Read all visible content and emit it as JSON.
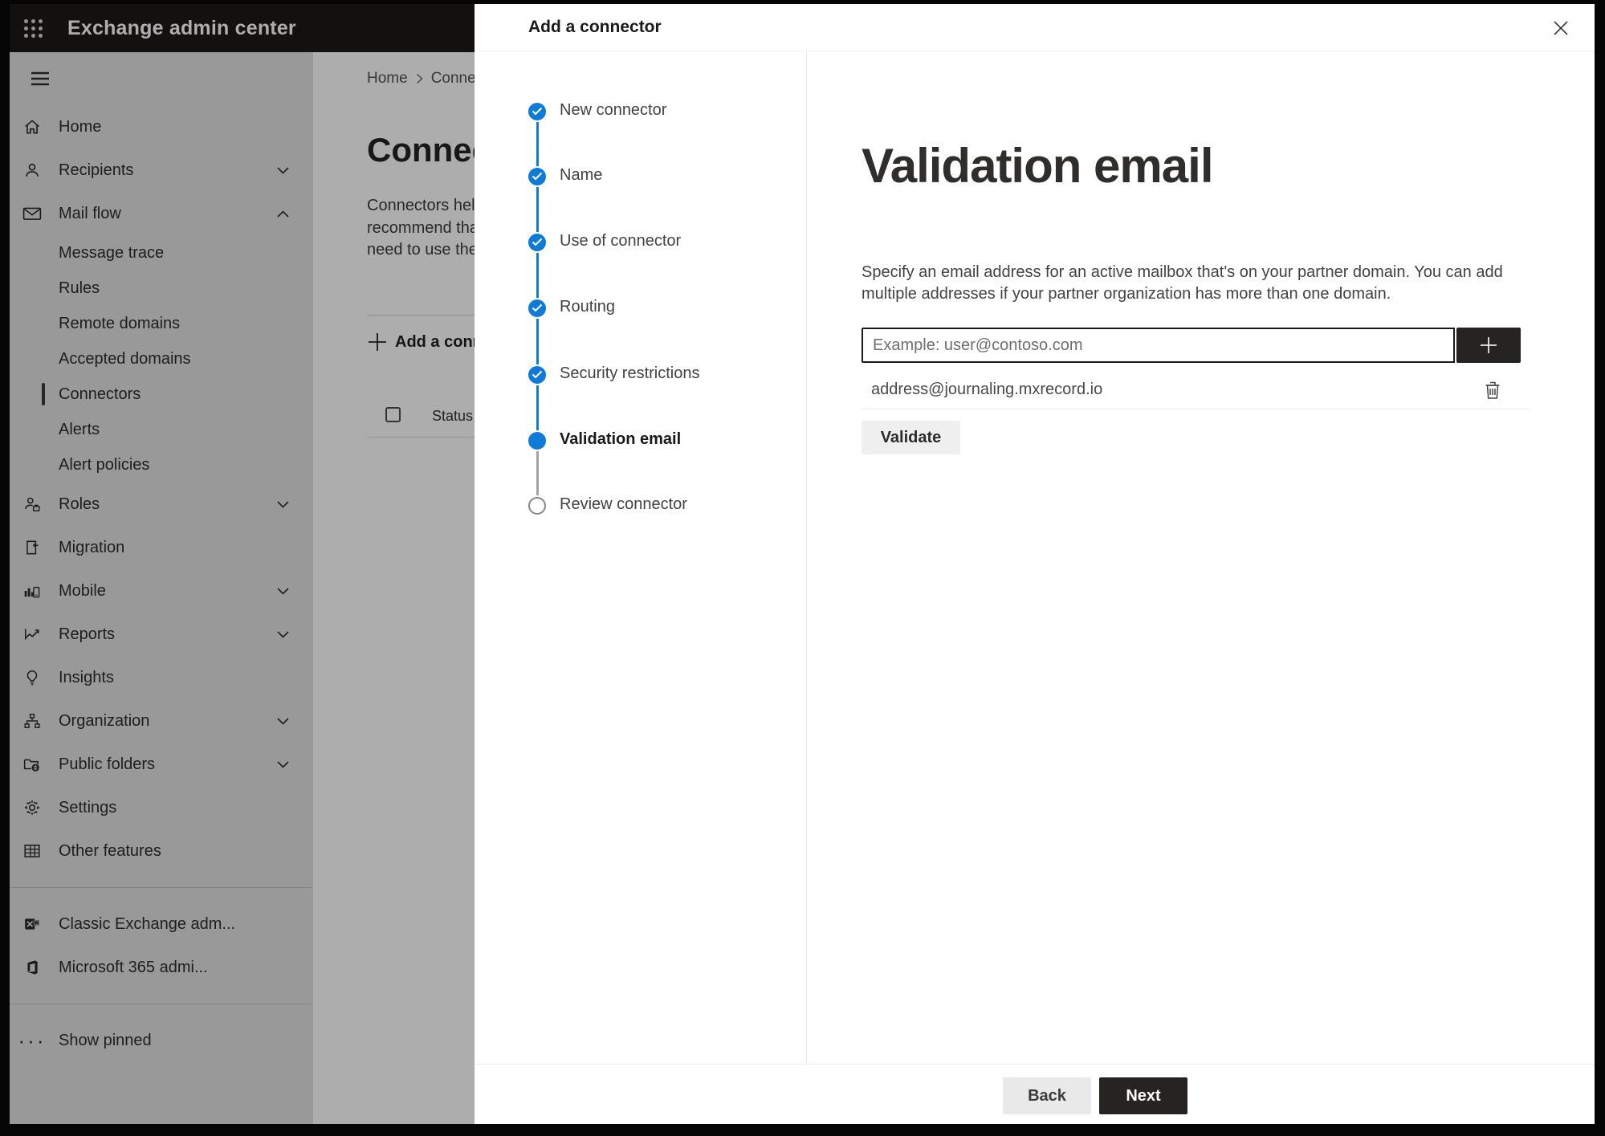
{
  "topbar": {
    "title": "Exchange admin center"
  },
  "sidebar": {
    "items": [
      {
        "label": "Home"
      },
      {
        "label": "Recipients"
      },
      {
        "label": "Mail flow"
      },
      {
        "label": "Message trace"
      },
      {
        "label": "Rules"
      },
      {
        "label": "Remote domains"
      },
      {
        "label": "Accepted domains"
      },
      {
        "label": "Connectors"
      },
      {
        "label": "Alerts"
      },
      {
        "label": "Alert policies"
      },
      {
        "label": "Roles"
      },
      {
        "label": "Migration"
      },
      {
        "label": "Mobile"
      },
      {
        "label": "Reports"
      },
      {
        "label": "Insights"
      },
      {
        "label": "Organization"
      },
      {
        "label": "Public folders"
      },
      {
        "label": "Settings"
      },
      {
        "label": "Other features"
      }
    ],
    "footer_items": [
      {
        "label": "Classic Exchange adm..."
      },
      {
        "label": "Microsoft 365 admi..."
      }
    ],
    "show_pinned_label": "Show pinned"
  },
  "background": {
    "breadcrumb_home": "Home",
    "breadcrumb_current": "Conne",
    "title": "Connec",
    "body_line1": "Connectors help",
    "body_line2": "recommend tha",
    "body_line3": "need to use ther",
    "add_button_label": "Add a conn",
    "status_header": "Status"
  },
  "modal": {
    "title": "Add a connector",
    "steps": [
      {
        "label": "New connector",
        "state": "done"
      },
      {
        "label": "Name",
        "state": "done"
      },
      {
        "label": "Use of connector",
        "state": "done"
      },
      {
        "label": "Routing",
        "state": "done"
      },
      {
        "label": "Security restrictions",
        "state": "done"
      },
      {
        "label": "Validation email",
        "state": "active"
      },
      {
        "label": "Review connector",
        "state": "todo"
      }
    ],
    "content": {
      "heading": "Validation email",
      "body_line1": "Specify an email address for an active mailbox that's on your partner domain. You can add",
      "body_line2": "multiple addresses if your partner organization has more than one domain.",
      "input_placeholder": "Example: user@contoso.com",
      "address": "address@journaling.mxrecord.io",
      "validate_label": "Validate"
    },
    "footer": {
      "back_label": "Back",
      "next_label": "Next"
    }
  },
  "colors": {
    "accent_blue": "#0d7bd7",
    "dark_button": "#252423",
    "topbar_bg": "#1b1a19"
  }
}
